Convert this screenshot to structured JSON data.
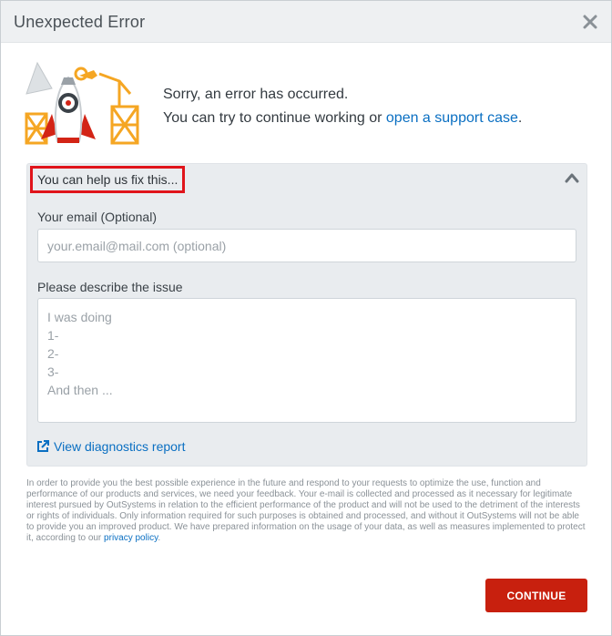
{
  "dialog": {
    "title": "Unexpected Error",
    "close_icon": "close-icon"
  },
  "message": {
    "line1": "Sorry, an error has occurred.",
    "line2_prefix": "You can try to continue working or ",
    "support_link": "open a support case",
    "line2_suffix": "."
  },
  "feedback": {
    "header": "You can help us fix this...",
    "collapse_icon": "chevron-up-icon",
    "email_label": "Your email (Optional)",
    "email_placeholder": "your.email@mail.com (optional)",
    "email_value": "",
    "issue_label": "Please describe the issue",
    "issue_placeholder": "I was doing\n1-\n2-\n3-\nAnd then ...",
    "issue_value": "",
    "diagnostics_icon": "external-link-icon",
    "diagnostics_link": "View diagnostics report"
  },
  "legal": {
    "text": "In order to provide you the best possible experience in the future and respond to your requests to optimize the use, function and performance of our products and services, we need your feedback. Your e-mail is collected and processed as it necessary for legitimate interest pursued by OutSystems in relation to the efficient performance of the product and will not be used to the detriment of the interests or rights of individuals. Only information required for such purposes is obtained and processed, and without it OutSystems will not be able to provide you an improved product. We have prepared information on the usage of your data, as well as measures implemented to protect it, according to our ",
    "privacy_link": "privacy policy",
    "suffix": "."
  },
  "actions": {
    "continue_label": "CONTINUE"
  },
  "colors": {
    "accent": "#c8200e",
    "link": "#0a6fc2",
    "highlight_border": "#e0141b",
    "panel_bg": "#e9ecef"
  }
}
